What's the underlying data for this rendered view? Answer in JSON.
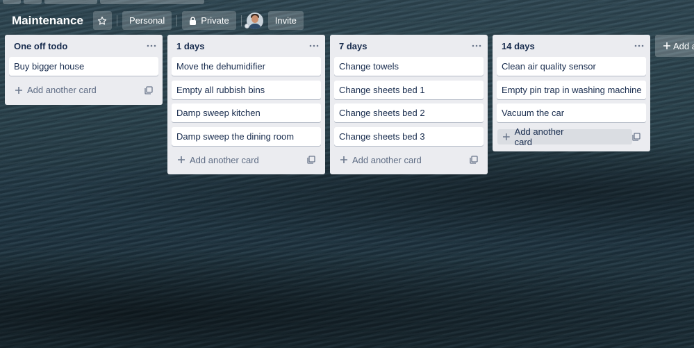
{
  "board": {
    "title": "Maintenance",
    "personal_label": "Personal",
    "private_label": "Private",
    "invite_label": "Invite"
  },
  "icons": {
    "star": "star-icon",
    "lock": "lock-icon",
    "menu": "more-horizontal-icon",
    "plus": "plus-icon",
    "template": "card-template-icon"
  },
  "colors": {
    "list_bg": "#ebecf0",
    "card_bg": "#ffffff",
    "text": "#172b4d",
    "muted": "#5e6c84"
  },
  "lists": [
    {
      "title": "One off todo",
      "cards": [
        "Buy bigger house"
      ],
      "add_label": "Add another card"
    },
    {
      "title": "1 days",
      "cards": [
        "Move the dehumidifier",
        "Empty all rubbish bins",
        "Damp sweep kitchen",
        "Damp sweep the dining room"
      ],
      "add_label": "Add another card"
    },
    {
      "title": "7 days",
      "cards": [
        "Change towels",
        "Change sheets bed 1",
        "Change sheets bed 2",
        "Change sheets bed 3"
      ],
      "add_label": "Add another card"
    },
    {
      "title": "14 days",
      "cards": [
        "Clean air quality sensor",
        "Empty pin trap in washing machine",
        "Vacuum the car"
      ],
      "add_label": "Add another card"
    }
  ],
  "add_list_label": "Add a"
}
